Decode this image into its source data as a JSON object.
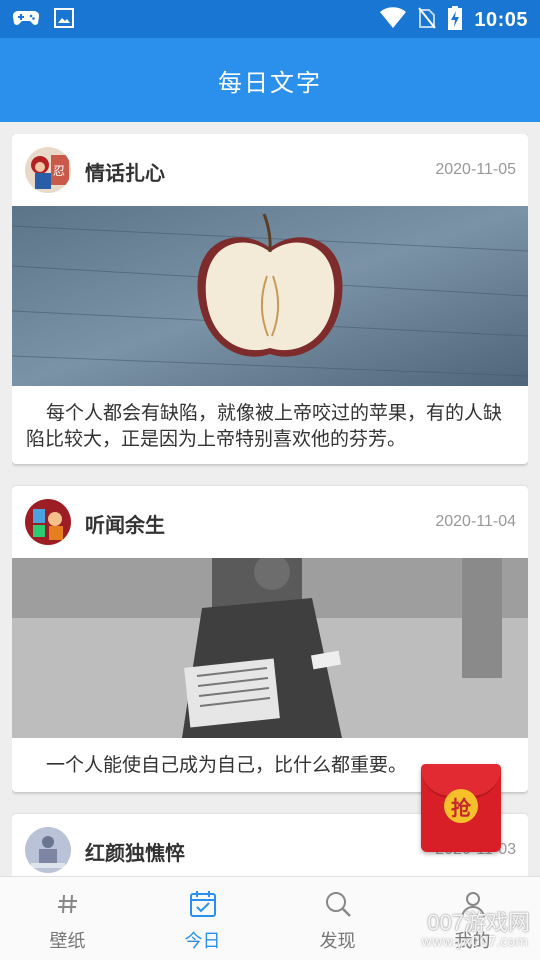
{
  "status_bar": {
    "time": "10:05",
    "icons": [
      "gamepad-icon",
      "image-icon",
      "wifi-icon",
      "no-sim-icon",
      "battery-charging-icon"
    ]
  },
  "app_bar": {
    "title": "每日文字"
  },
  "cards": [
    {
      "title": "情话扎心",
      "date": "2020-11-05",
      "text": "每个人都会有缺陷，就像被上帝咬过的苹果，有的人缺陷比较大，正是因为上帝特别喜欢他的芬芳。",
      "image": "apple-photo"
    },
    {
      "title": "听闻余生",
      "date": "2020-11-04",
      "text": "一个人能使自己成为自己，比什么都重要。",
      "image": "newspaper-seller-photo"
    },
    {
      "title": "红颜独憔悴",
      "date": "2020-11-03",
      "text": "",
      "image": ""
    }
  ],
  "red_packet": {
    "label": "抢"
  },
  "bottom_nav": [
    {
      "label": "壁纸",
      "icon": "hash-icon",
      "active": false
    },
    {
      "label": "今日",
      "icon": "calendar-check-icon",
      "active": true
    },
    {
      "label": "发现",
      "icon": "search-icon",
      "active": false
    },
    {
      "label": "我的",
      "icon": "person-icon",
      "active": false
    }
  ],
  "watermark": {
    "text": "007游戏网",
    "url": "www.yx007.com"
  },
  "colors": {
    "primary": "#2b90ec",
    "status_bar": "#1976d2",
    "red_packet": "#d81e26"
  }
}
